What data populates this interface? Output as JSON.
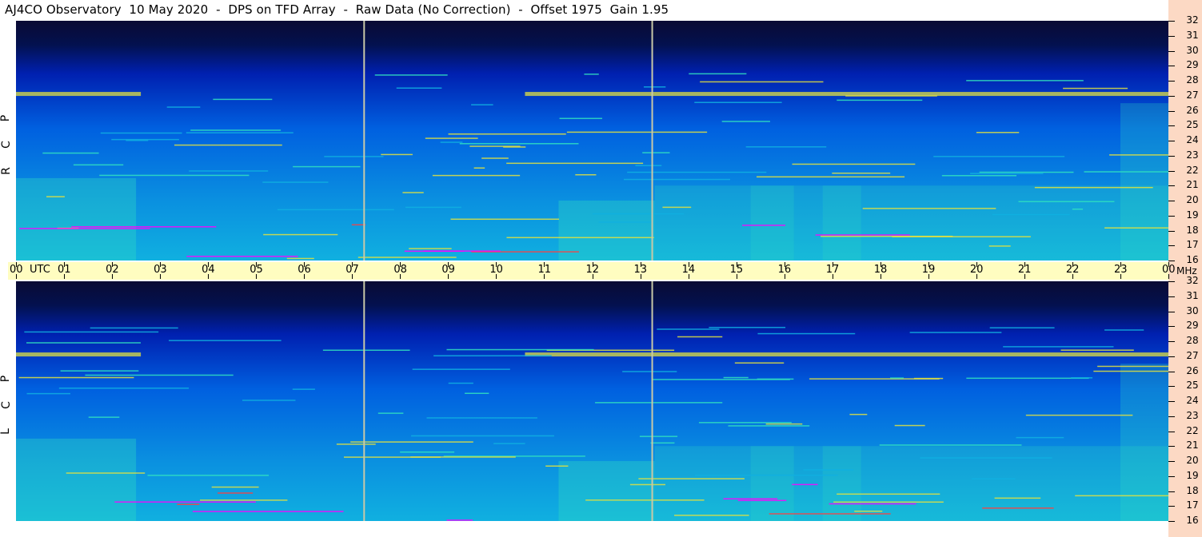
{
  "title": "AJ4CO Observatory  10 May 2020  -  DPS on TFD Array  -  Raw Data (No Correction)  -  Offset 1975  Gain 1.95",
  "chart_data": [
    {
      "type": "heatmap",
      "panel": "RCP",
      "side_label": [
        "R",
        "C",
        "P"
      ],
      "x_unit": "UTC",
      "x_ticks": [
        "00",
        "01",
        "02",
        "03",
        "04",
        "05",
        "06",
        "07",
        "08",
        "09",
        "10",
        "11",
        "12",
        "13",
        "14",
        "15",
        "16",
        "17",
        "18",
        "19",
        "20",
        "21",
        "22",
        "23",
        "00"
      ],
      "x_range_hours": [
        0,
        24
      ],
      "y_unit": "MHz",
      "y_ticks": [
        "16",
        "17",
        "18",
        "19",
        "20",
        "21",
        "22",
        "23",
        "24",
        "25",
        "26",
        "27",
        "28",
        "29",
        "30",
        "31",
        "32"
      ],
      "y_range_mhz": [
        16,
        32
      ],
      "markers_utc": [
        7.25,
        13.25
      ],
      "colormap": [
        "#0a0a33",
        "#0020b0",
        "#0060e0",
        "#10b0e0",
        "#30e0c0",
        "#e0e040",
        "#ff4040",
        "#ff00ff"
      ]
    },
    {
      "type": "heatmap",
      "panel": "LCP",
      "side_label": [
        "L",
        "C",
        "P"
      ],
      "x_unit": "UTC",
      "x_range_hours": [
        0,
        24
      ],
      "y_unit": "MHz",
      "y_ticks": [
        "16",
        "17",
        "18",
        "19",
        "20",
        "21",
        "22",
        "23",
        "24",
        "25",
        "26",
        "27",
        "28",
        "29",
        "30",
        "31",
        "32"
      ],
      "y_range_mhz": [
        16,
        32
      ],
      "markers_utc": [
        7.25,
        13.25
      ]
    }
  ],
  "time_axis": {
    "utc_label": "UTC",
    "mhz_label": "MHz"
  }
}
